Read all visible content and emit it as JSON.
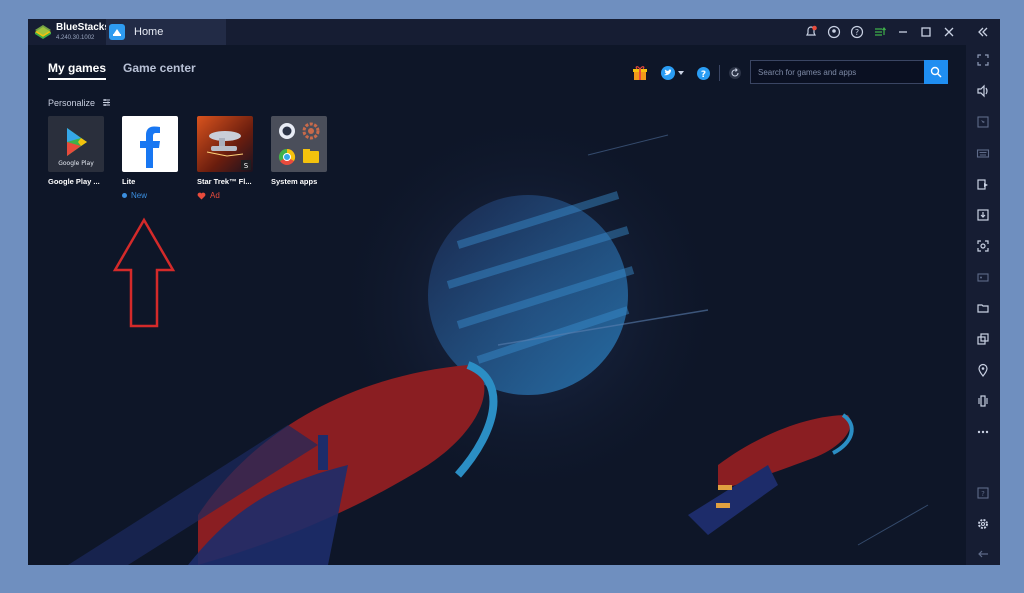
{
  "titlebar": {
    "app_name": "BlueStacks",
    "version": "4.240.30.1002",
    "home_tab": "Home"
  },
  "nav": {
    "tabs": [
      {
        "label": "My games",
        "active": true
      },
      {
        "label": "Game center",
        "active": false
      }
    ],
    "personalize": "Personalize"
  },
  "apps": [
    {
      "name": "Google Play ...",
      "badge": ""
    },
    {
      "name": "Lite",
      "badge": "New"
    },
    {
      "name": "Star Trek™ Fl...",
      "badge": "Ad"
    },
    {
      "name": "System apps",
      "badge": ""
    }
  ],
  "search": {
    "placeholder": "Search for games and apps"
  },
  "colors": {
    "accent": "#1f8ef1",
    "background": "#0e1628",
    "chrome": "#161d33",
    "arrow": "#d42a2a",
    "ad": "#e84b3c",
    "new": "#3b8fe0"
  },
  "icons": {
    "titlebar": [
      "notification-bell-icon",
      "account-icon",
      "help-circle-icon",
      "menu-sort-icon",
      "minimize-icon",
      "maximize-icon",
      "close-icon",
      "collapse-sidebar-icon"
    ],
    "sidebar": [
      "fullscreen-icon",
      "volume-icon",
      "pointer-icon",
      "keyboard-icon",
      "copy-paste-icon",
      "install-apk-icon",
      "screenshot-icon",
      "record-video-icon",
      "folder-icon",
      "multi-instance-icon",
      "location-icon",
      "shake-icon",
      "more-icon",
      "help-icon",
      "settings-icon",
      "back-icon"
    ],
    "topright": [
      "gift-icon",
      "twitter-icon",
      "help-blue-icon",
      "refresh-icon",
      "search-icon"
    ]
  }
}
